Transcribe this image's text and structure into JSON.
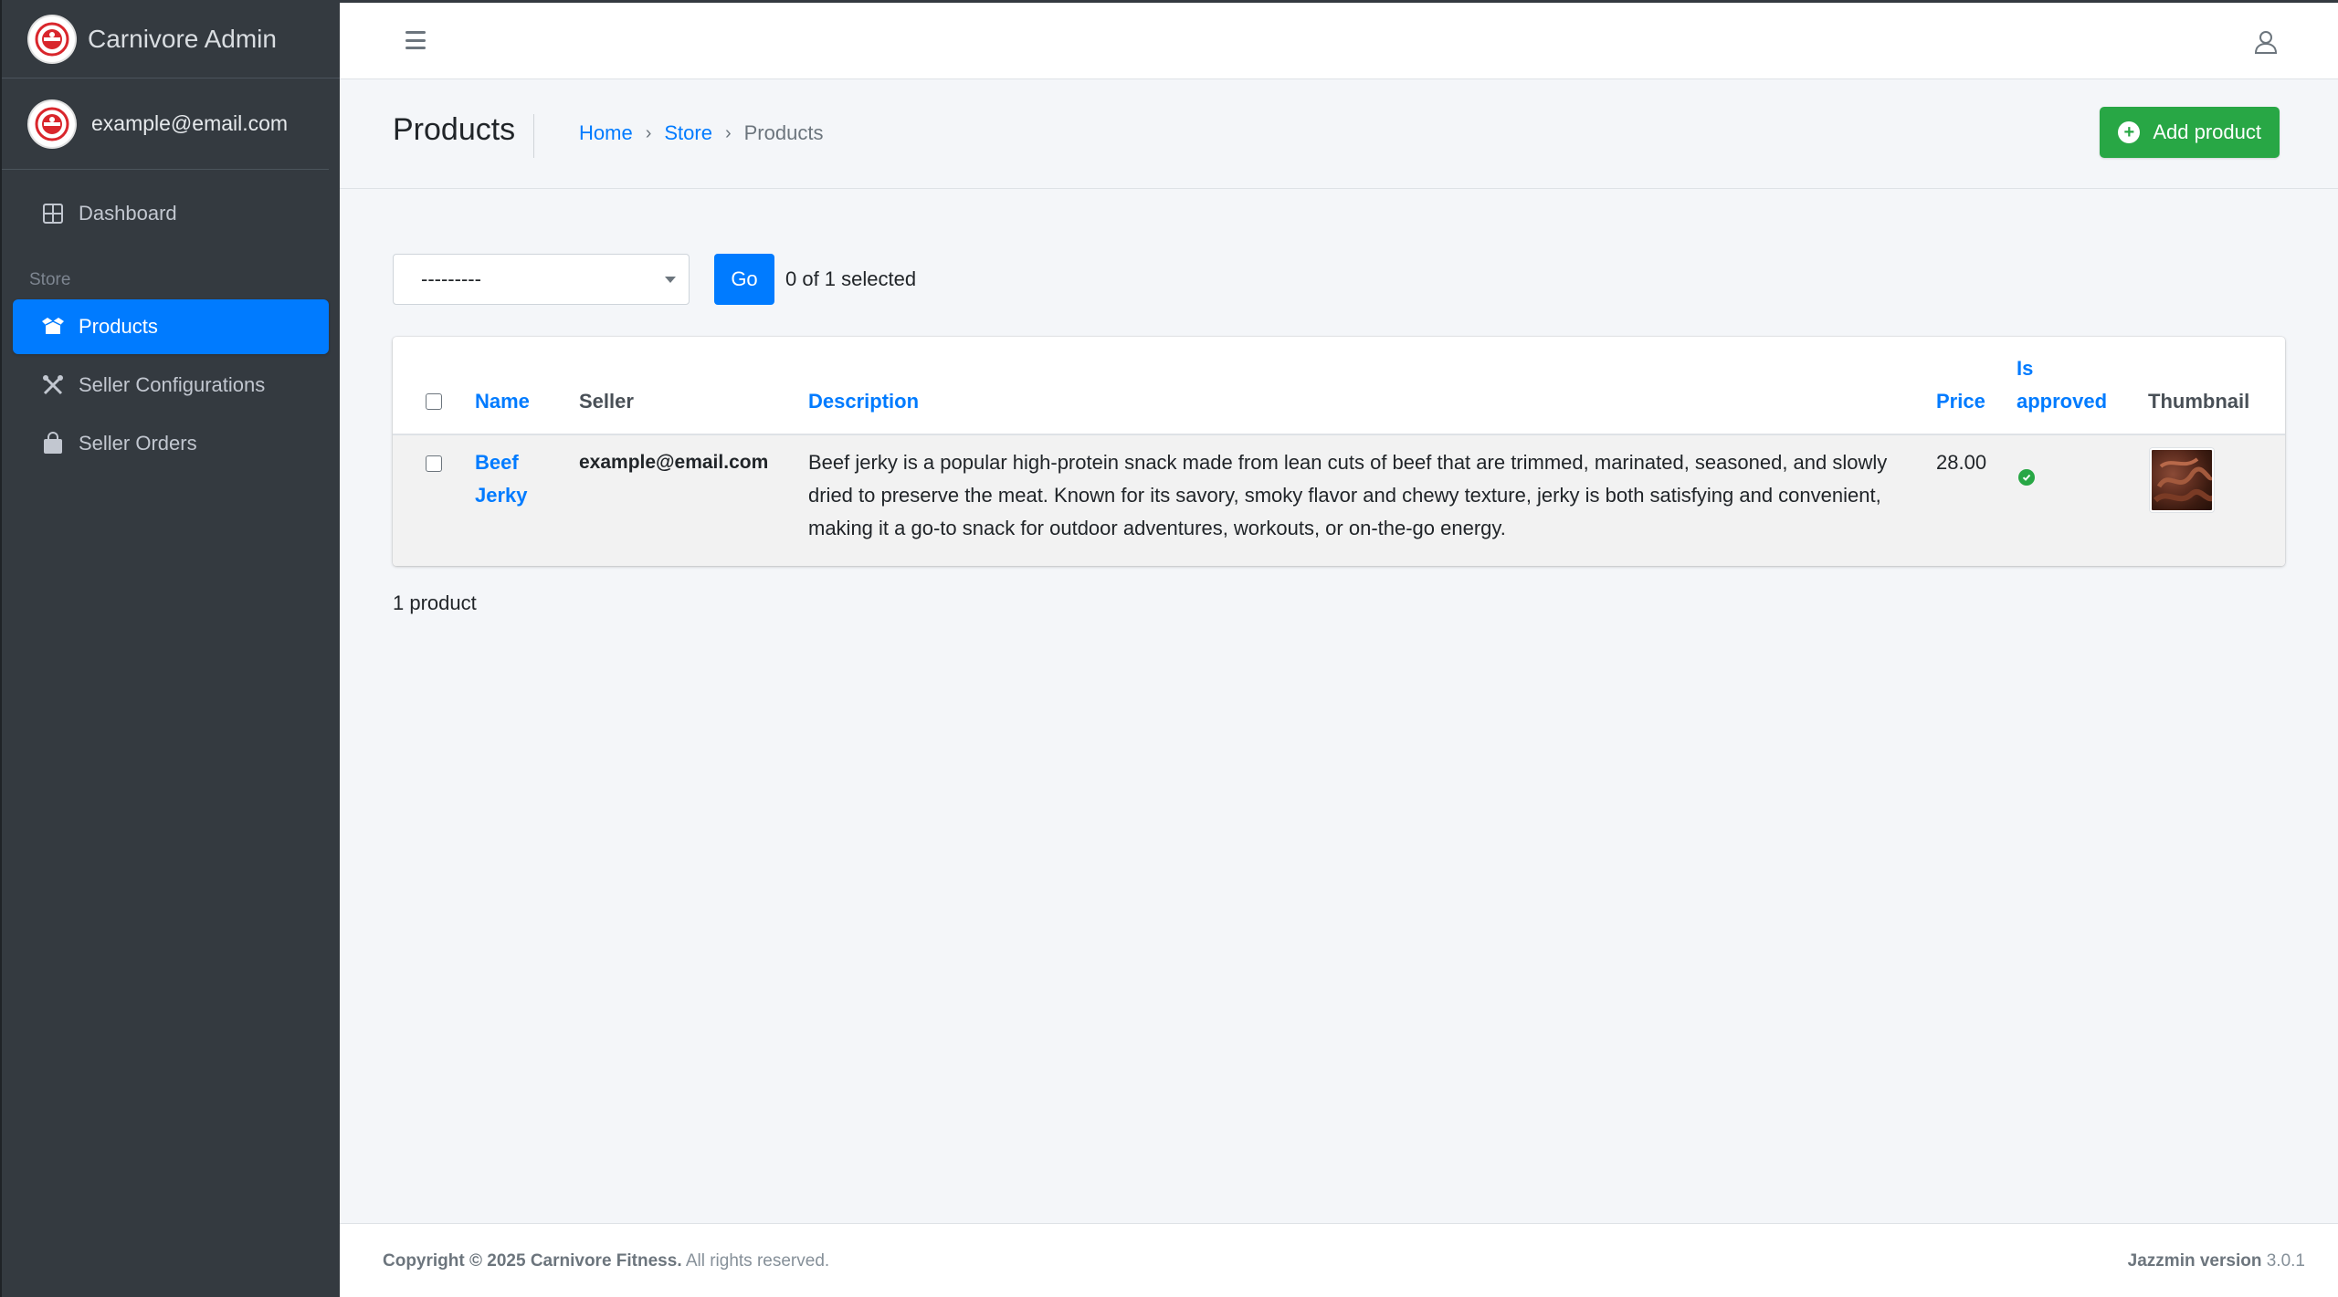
{
  "app": {
    "brand": "Carnivore Admin",
    "user_email": "example@email.com"
  },
  "sidebar": {
    "items": [
      {
        "label": "Dashboard",
        "icon": "dashboard-icon"
      },
      {
        "label": "Products",
        "icon": "box-icon",
        "active": true
      },
      {
        "label": "Seller Configurations",
        "icon": "tools-icon"
      },
      {
        "label": "Seller Orders",
        "icon": "shopping-bag-icon"
      }
    ],
    "section_header": "Store"
  },
  "header": {
    "title": "Products",
    "breadcrumb": [
      "Home",
      "Store",
      "Products"
    ],
    "add_button": "Add product"
  },
  "actions": {
    "select_value": "---------",
    "go_label": "Go",
    "selected_text": "0 of 1 selected"
  },
  "table": {
    "columns": {
      "name": "Name",
      "seller": "Seller",
      "description": "Description",
      "price": "Price",
      "approved_1": "Is",
      "approved_2": "approved",
      "thumbnail": "Thumbnail"
    },
    "rows": [
      {
        "name_1": "Beef",
        "name_2": "Jerky",
        "seller": "example@email.com",
        "description_1": "Beef jerky is a popular high-protein snack made from lean cuts of beef that are trimmed, marinated, seasoned, and slowly",
        "description_2": "dried to preserve the meat. Known for its savory, smoky flavor and chewy texture, jerky is both satisfying and convenient,",
        "description_3": "making it a go-to snack for outdoor adventures, workouts, or on-the-go energy.",
        "price": "28.00",
        "is_approved": true
      }
    ]
  },
  "paginator": "1 product",
  "footer": {
    "copyright_bold": "Copyright © 2025 Carnivore Fitness.",
    "copyright_rest": "All rights reserved.",
    "version_bold": "Jazzmin version",
    "version": "3.0.1"
  },
  "colors": {
    "primary": "#007bff",
    "success": "#28a745",
    "sidebar": "#343a40"
  }
}
